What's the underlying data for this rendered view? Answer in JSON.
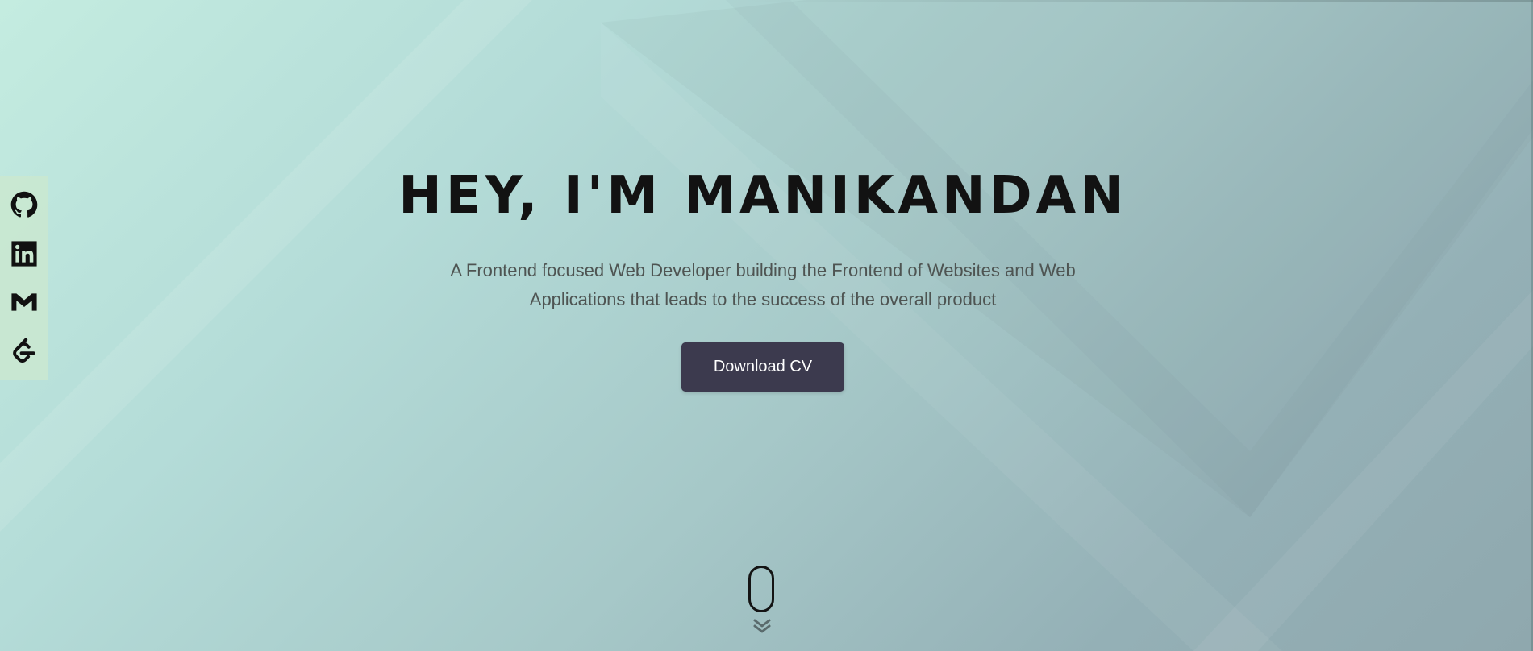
{
  "hero": {
    "title": "HEY, I'M MANIKANDAN",
    "subtitle": "A Frontend focused Web Developer building the Frontend of Websites and Web Applications that leads to the success of the overall product",
    "cta_label": "Download CV"
  },
  "social": [
    {
      "name": "github",
      "icon": "github-icon"
    },
    {
      "name": "linkedin",
      "icon": "linkedin-icon"
    },
    {
      "name": "gmail",
      "icon": "gmail-icon"
    },
    {
      "name": "leetcode",
      "icon": "leetcode-icon"
    }
  ],
  "scroll": {
    "icon": "mouse-scroll-icon",
    "arrow_icon": "double-chevron-down-icon"
  },
  "colors": {
    "button_bg": "#3c3a4e",
    "title": "#121212",
    "subtitle": "#4e5452",
    "sidebar_bg": "#cae8d0"
  }
}
